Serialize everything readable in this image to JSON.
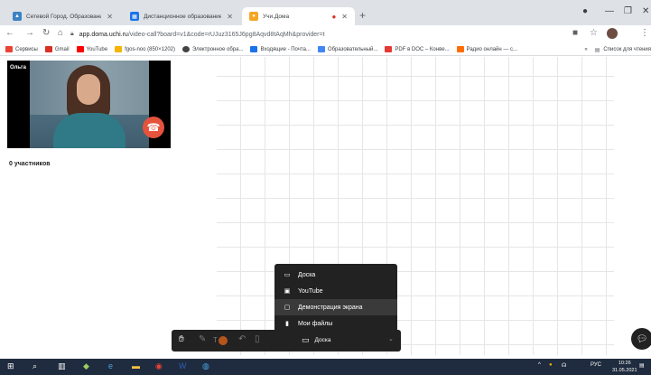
{
  "browser": {
    "tabs": [
      {
        "title": "Сетевой Город. Образование",
        "favicon": "school-icon",
        "color": "#3b82c4"
      },
      {
        "title": "Дистанционное образование ...",
        "favicon": "grid-icon",
        "color": "#1a73e8"
      },
      {
        "title": "Учи.Дома",
        "favicon": "uchi-icon",
        "color": "#f5a623",
        "active": true
      }
    ],
    "url": {
      "host": "app.doma.uchi.ru",
      "path": "/video-call?board=v1&code=rUJuz3165J6pg8Aqvd8tAqMh&provider=t"
    },
    "bookmarks": [
      {
        "label": "Сервисы",
        "color": "#ea4335"
      },
      {
        "label": "Gmail",
        "color": "#d93025"
      },
      {
        "label": "YouTube",
        "color": "#ff0000"
      },
      {
        "label": "fgos-noo (850×1202)",
        "color": "#f4b400"
      },
      {
        "label": "Электронное обра...",
        "color": "#444444"
      },
      {
        "label": "Входящие - Почта...",
        "color": "#1a73e8"
      },
      {
        "label": "Образовательный...",
        "color": "#4285f4"
      },
      {
        "label": "PDF в DOC – Конве...",
        "color": "#e53935"
      },
      {
        "label": "Радио онлайн — с...",
        "color": "#ff6d00"
      }
    ],
    "bookmarks_more": "»",
    "bookmarks_other": "Список для чтения"
  },
  "call": {
    "user_name": "Ольга",
    "participants": "0 участников"
  },
  "menu": {
    "items": [
      {
        "label": "Доска",
        "icon": "board-icon"
      },
      {
        "label": "YouTube",
        "icon": "youtube-icon"
      },
      {
        "label": "Демонстрация экрана",
        "icon": "screen-icon",
        "highlighted": true
      },
      {
        "label": "Мои файлы",
        "icon": "file-icon"
      }
    ]
  },
  "board_toolbar": {
    "selected": "Доска",
    "accent_color": "#b5551b"
  },
  "taskbar": {
    "lang": "РУС",
    "time": "10:26",
    "date": "31.05.2021"
  }
}
